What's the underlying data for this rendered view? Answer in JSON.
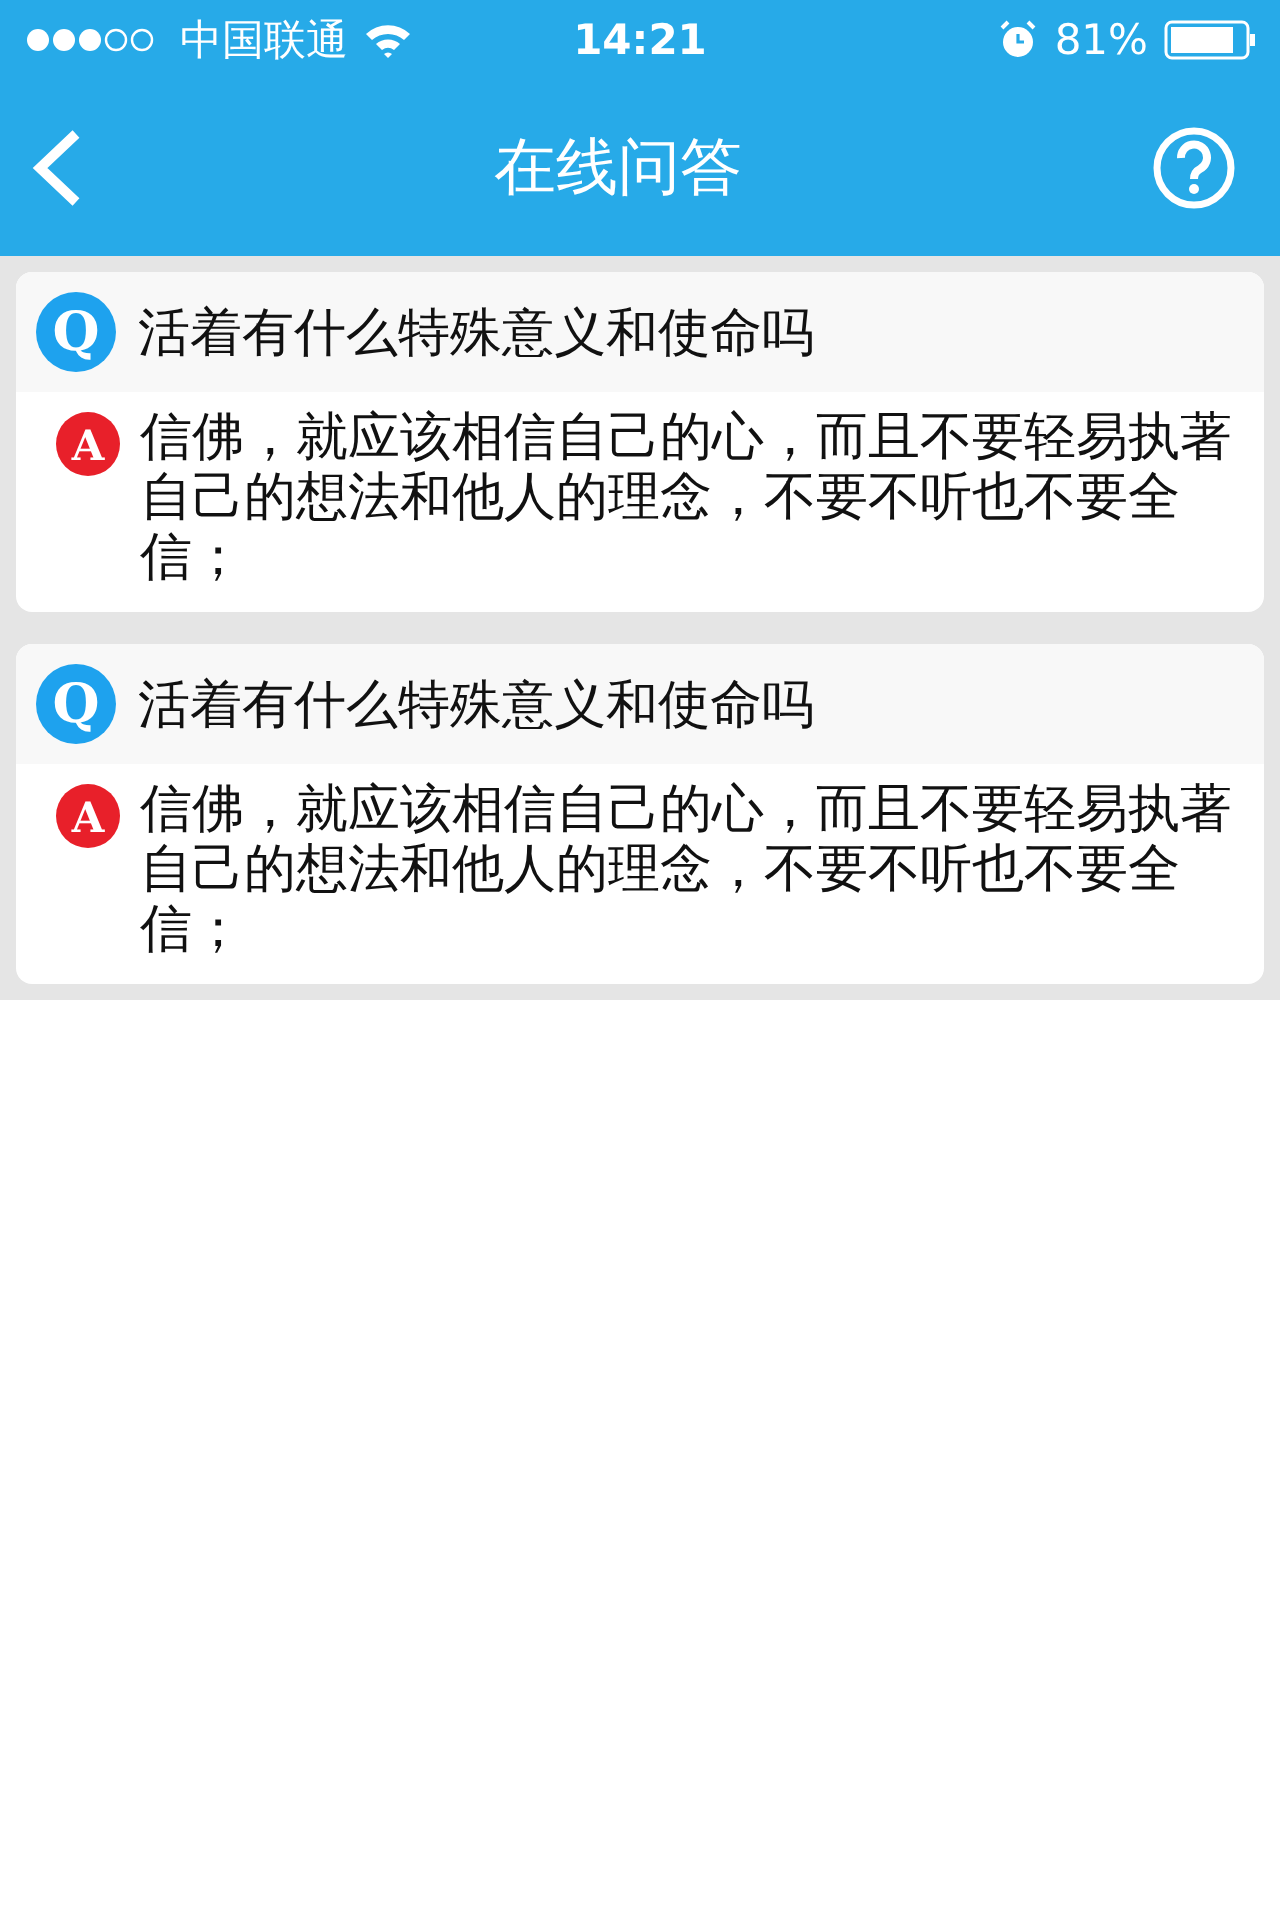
{
  "status_bar": {
    "carrier": "中国联通",
    "time": "14:21",
    "battery": "81%"
  },
  "nav": {
    "title": "在线问答"
  },
  "qa": [
    {
      "q_mark": "Q",
      "question": "活着有什么特殊意义和使命吗",
      "a_mark": "A",
      "answer": "信佛，就应该相信自己的心，而且不要轻易执著自己的想法和他人的理念，不要不听也不要全信；"
    },
    {
      "q_mark": "Q",
      "question": "活着有什么特殊意义和使命吗",
      "a_mark": "A",
      "answer": "信佛，就应该相信自己的心，而且不要轻易执著自己的想法和他人的理念，不要不听也不要全信；"
    }
  ]
}
